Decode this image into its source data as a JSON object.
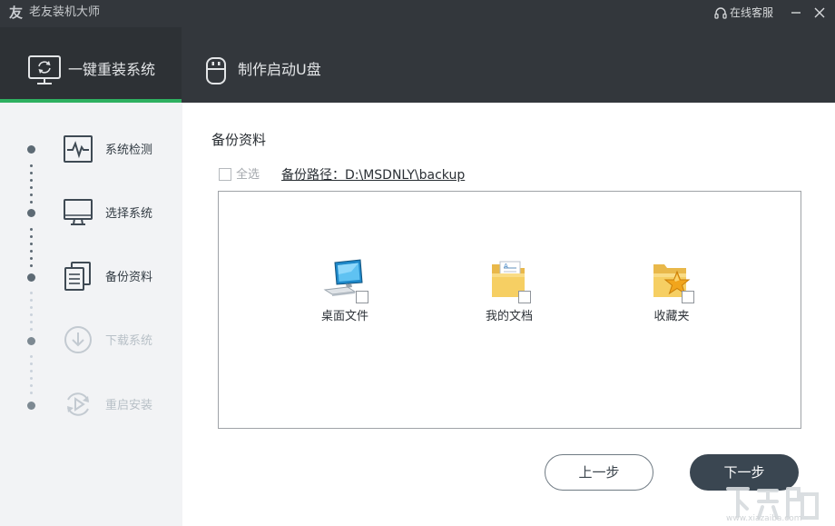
{
  "app": {
    "title": "老友装机大师",
    "logo_glyph": "友",
    "customer_service": "在线客服"
  },
  "tabs": [
    {
      "label": "一键重装系统",
      "active": true
    },
    {
      "label": "制作启动U盘",
      "active": false
    }
  ],
  "steps": [
    {
      "label": "系统检测",
      "icon": "heartbeat-monitor-icon",
      "state": "done"
    },
    {
      "label": "选择系统",
      "icon": "monitor-icon",
      "state": "done"
    },
    {
      "label": "备份资料",
      "icon": "documents-icon",
      "state": "current"
    },
    {
      "label": "下载系统",
      "icon": "download-icon",
      "state": "pending"
    },
    {
      "label": "重启安装",
      "icon": "restart-icon",
      "state": "pending"
    }
  ],
  "main": {
    "title": "备份资料",
    "select_all": "全选",
    "backup_path": "备份路径：D:\\MSDNLY\\backup",
    "items": [
      {
        "label": "桌面文件",
        "icon": "desktop-computer-icon",
        "checked": false
      },
      {
        "label": "我的文档",
        "icon": "documents-folder-icon",
        "checked": false
      },
      {
        "label": "收藏夹",
        "icon": "favorites-folder-icon",
        "checked": false
      }
    ]
  },
  "buttons": {
    "prev": "上一步",
    "next": "下一步"
  },
  "watermark": {
    "text": "www.xiazaiba.com"
  },
  "colors": {
    "header_bg": "#33373c",
    "active_tab_underline": "#2eb060",
    "sidebar_bg": "#f2f3f5",
    "next_button_bg": "#3a4651"
  }
}
